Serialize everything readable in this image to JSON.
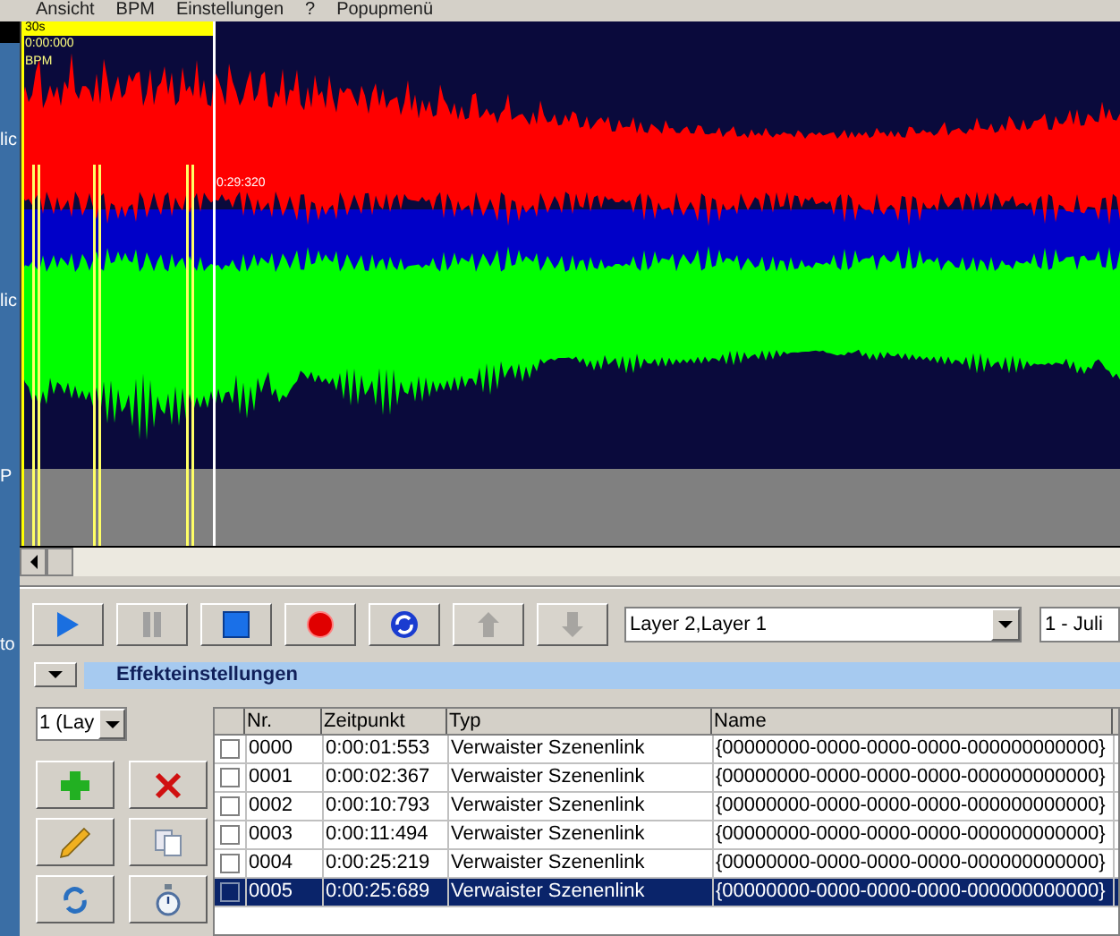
{
  "menu": [
    "Ansicht",
    "BPM",
    "Einstellungen",
    "?",
    "Popupmenü"
  ],
  "side_labels": [
    "lic",
    "lic",
    "P",
    "to"
  ],
  "waveform": {
    "duration_label": "30s",
    "start_time": "0:00:000",
    "bpm_label": "BPM",
    "cursor_time": "0:29:320"
  },
  "transport_buttons": [
    {
      "kind": "play",
      "disabled": false
    },
    {
      "kind": "pause",
      "disabled": false
    },
    {
      "kind": "stop",
      "disabled": false
    },
    {
      "kind": "record",
      "disabled": false
    },
    {
      "kind": "loop",
      "disabled": false
    },
    {
      "kind": "up",
      "disabled": true
    },
    {
      "kind": "down",
      "disabled": true
    }
  ],
  "layer_select": {
    "value": "Layer 2,Layer 1"
  },
  "scene_select": {
    "value": "1 - Juli"
  },
  "panel": {
    "title": "Effekteinstellungen"
  },
  "layer_dropdown": {
    "value": "1 (Lay"
  },
  "action_buttons": [
    {
      "kind": "add"
    },
    {
      "kind": "delete"
    },
    {
      "kind": "edit"
    },
    {
      "kind": "copy"
    },
    {
      "kind": "refresh"
    },
    {
      "kind": "timer"
    }
  ],
  "table": {
    "columns": [
      "Nr.",
      "Zeitpunkt",
      "Typ",
      "Name"
    ],
    "rows": [
      {
        "checked": false,
        "selected": false,
        "cells": [
          "0000",
          "0:00:01:553",
          "Verwaister Szenenlink",
          "{00000000-0000-0000-0000-000000000000}"
        ]
      },
      {
        "checked": false,
        "selected": false,
        "cells": [
          "0001",
          "0:00:02:367",
          "Verwaister Szenenlink",
          "{00000000-0000-0000-0000-000000000000}"
        ]
      },
      {
        "checked": false,
        "selected": false,
        "cells": [
          "0002",
          "0:00:10:793",
          "Verwaister Szenenlink",
          "{00000000-0000-0000-0000-000000000000}"
        ]
      },
      {
        "checked": false,
        "selected": false,
        "cells": [
          "0003",
          "0:00:11:494",
          "Verwaister Szenenlink",
          "{00000000-0000-0000-0000-000000000000}"
        ]
      },
      {
        "checked": false,
        "selected": false,
        "cells": [
          "0004",
          "0:00:25:219",
          "Verwaister Szenenlink",
          "{00000000-0000-0000-0000-000000000000}"
        ]
      },
      {
        "checked": false,
        "selected": true,
        "cells": [
          "0005",
          "0:00:25:689",
          "Verwaister Szenenlink",
          "{00000000-0000-0000-0000-000000000000}"
        ]
      }
    ]
  }
}
